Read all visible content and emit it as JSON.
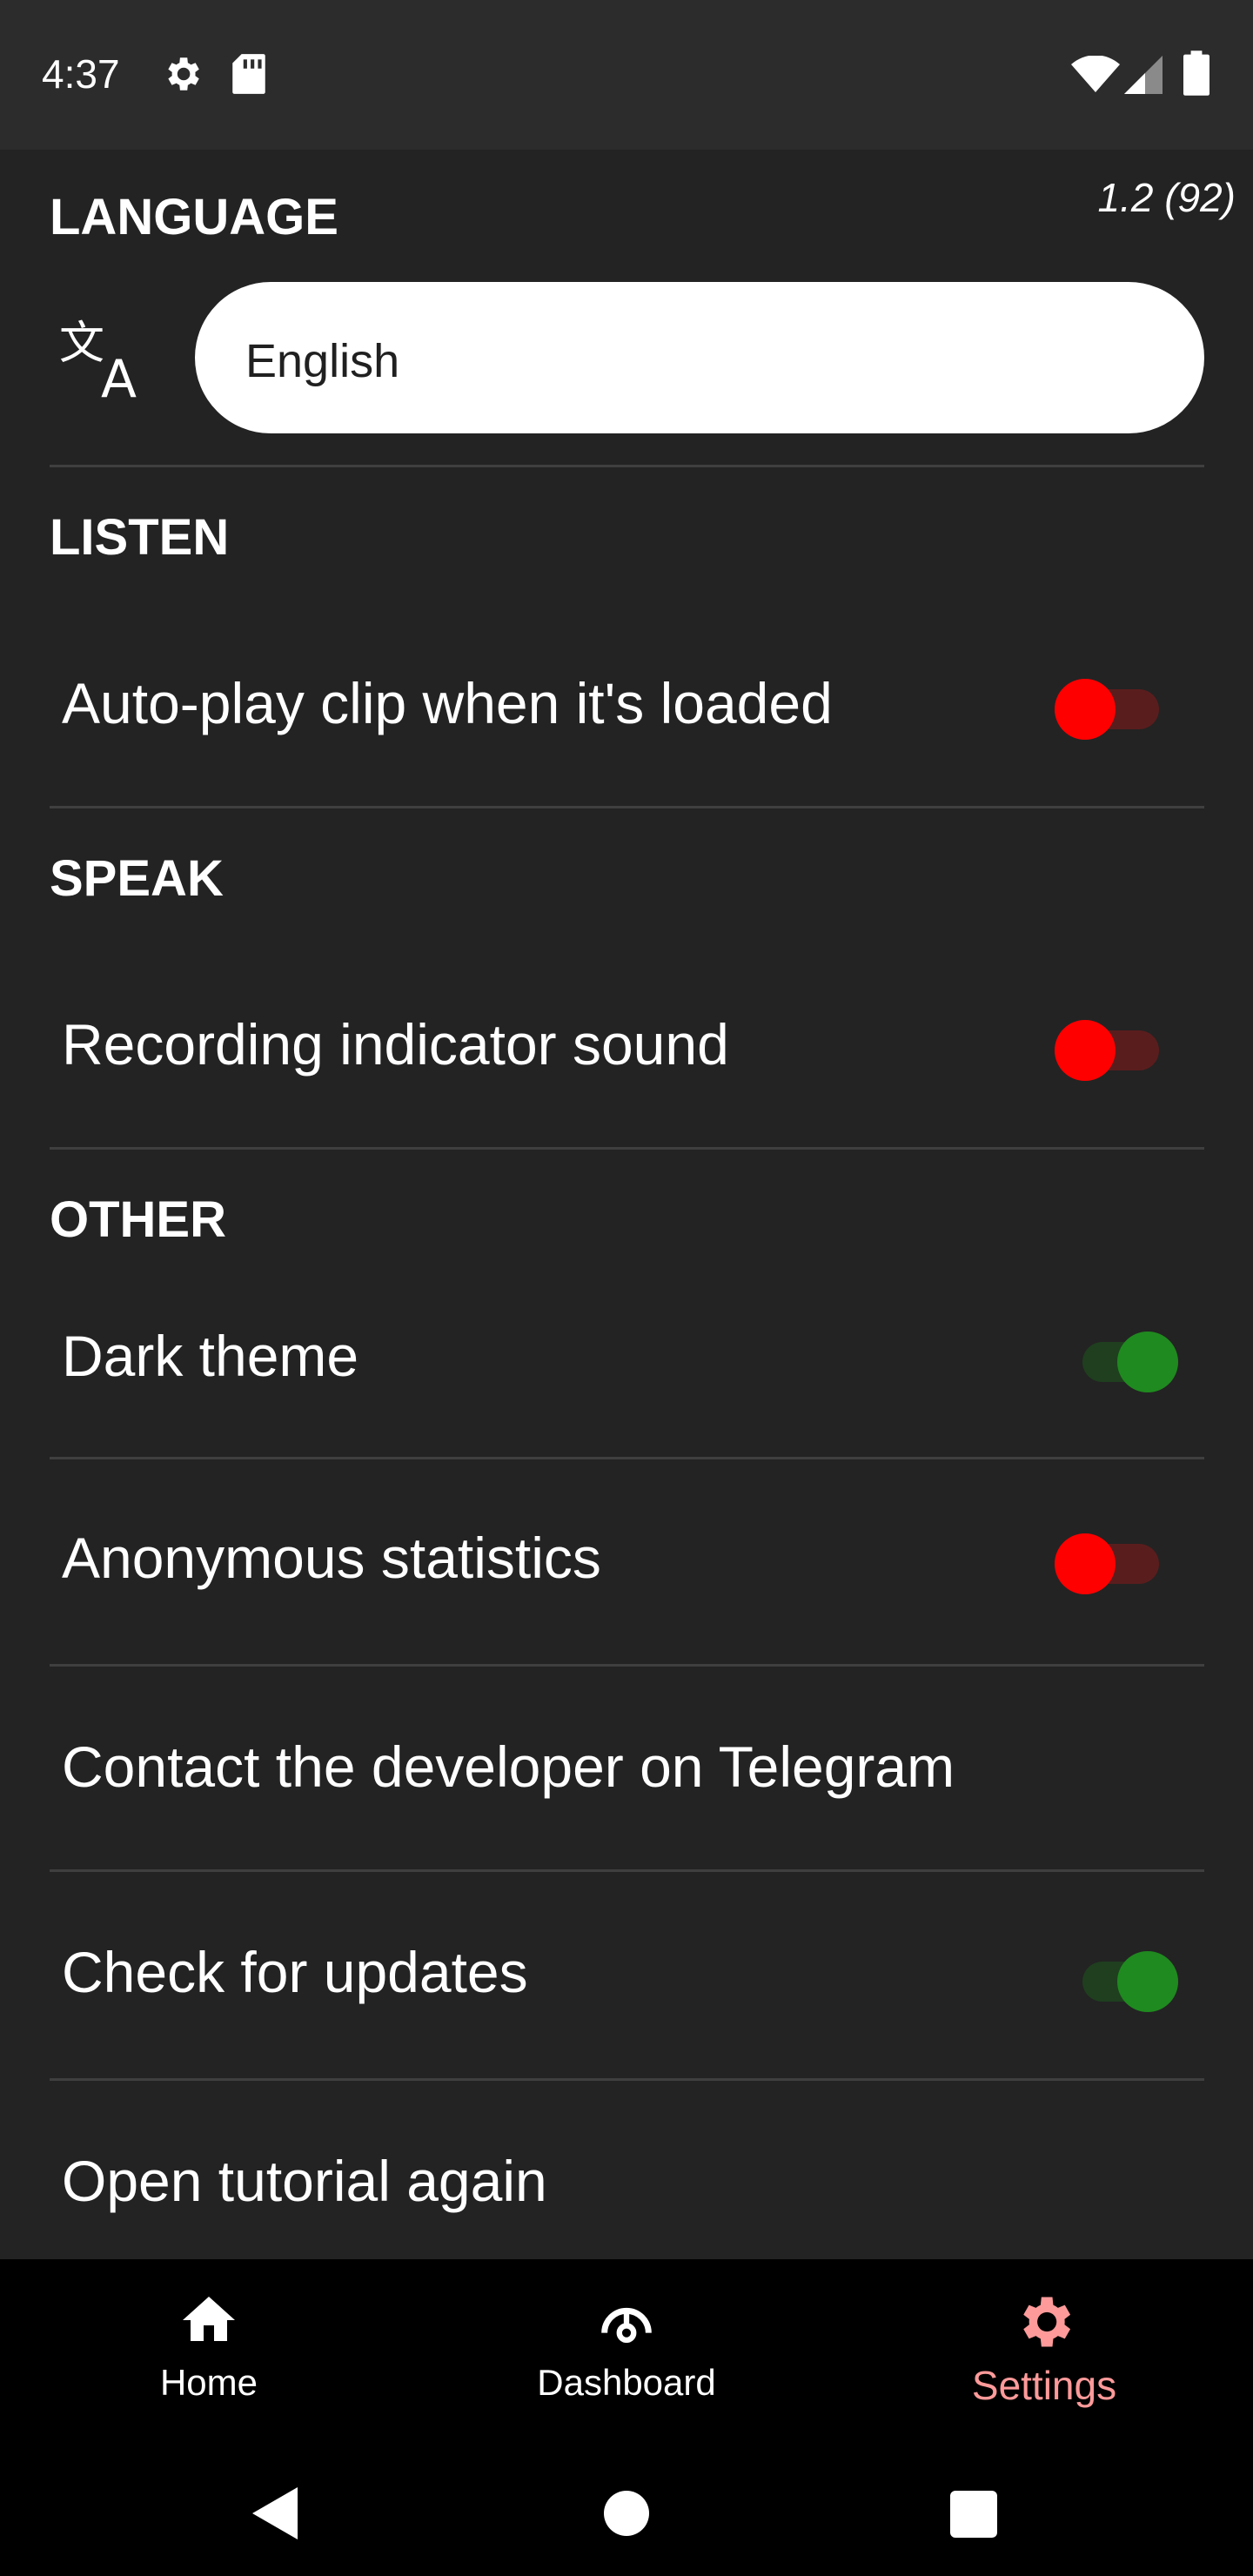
{
  "status_bar": {
    "time": "4:37",
    "left_icons": [
      "settings-icon",
      "sd-card-icon"
    ],
    "right_icons": [
      "wifi-icon",
      "signal-icon",
      "battery-icon"
    ]
  },
  "version": "1.2 (92)",
  "language": {
    "section_title": "LANGUAGE",
    "icon": "translate-icon",
    "selected": "English"
  },
  "listen": {
    "section_title": "LISTEN",
    "autoplay_label": "Auto-play clip when it's loaded",
    "autoplay_on": false
  },
  "speak": {
    "section_title": "SPEAK",
    "recording_sound_label": "Recording indicator sound",
    "recording_sound_on": false
  },
  "other": {
    "section_title": "OTHER",
    "dark_theme_label": "Dark theme",
    "dark_theme_on": true,
    "anon_stats_label": "Anonymous statistics",
    "anon_stats_on": false,
    "contact_label": "Contact the developer on Telegram",
    "updates_label": "Check for updates",
    "updates_on": true,
    "tutorial_label": "Open tutorial again"
  },
  "bottom_nav": {
    "items": [
      {
        "label": "Home",
        "icon": "home-icon"
      },
      {
        "label": "Dashboard",
        "icon": "dashboard-icon"
      },
      {
        "label": "Settings",
        "icon": "gear-icon",
        "active": true
      }
    ]
  },
  "colors": {
    "toggle_off": "#ff0000",
    "toggle_on": "#1f8a1f",
    "active_nav": "#ff9a9a"
  }
}
